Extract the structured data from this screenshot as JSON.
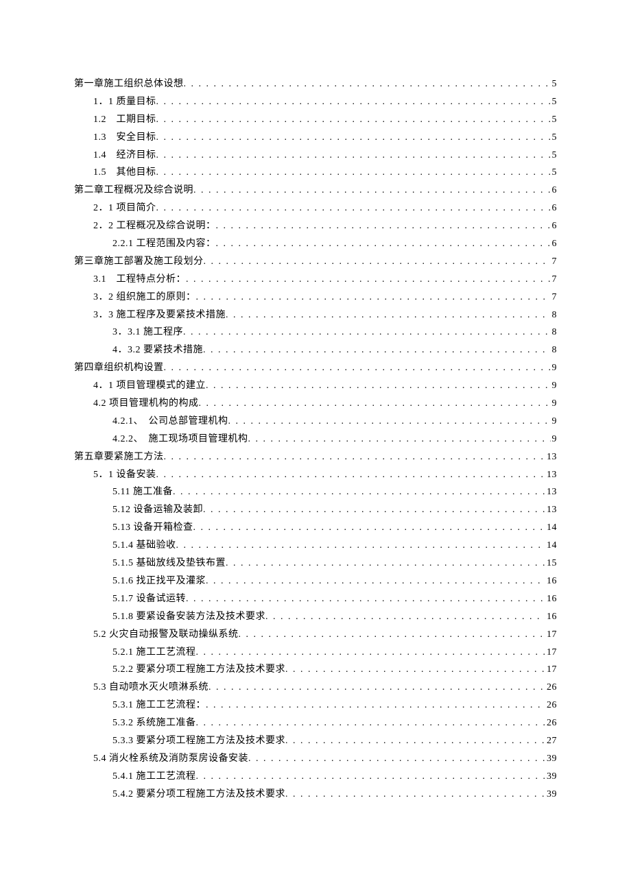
{
  "toc": [
    {
      "level": 0,
      "title": "第一章施工组织总体设想",
      "page": "5"
    },
    {
      "level": 1,
      "title": "1．1 质量目标",
      "page": "5"
    },
    {
      "level": 1,
      "title": "1.2　工期目标",
      "page": "5"
    },
    {
      "level": 1,
      "title": "1.3　安全目标",
      "page": "5"
    },
    {
      "level": 1,
      "title": "1.4　经济目标",
      "page": "5"
    },
    {
      "level": 1,
      "title": "1.5　其他目标",
      "page": "5"
    },
    {
      "level": 0,
      "title": "第二章工程概况及综合说明",
      "page": "6"
    },
    {
      "level": 1,
      "title": "2．1 项目简介",
      "page": "6"
    },
    {
      "level": 1,
      "title": "2．2 工程概况及综合说明：",
      "page": "6"
    },
    {
      "level": 2,
      "title": "2.2.1 工程范围及内容：",
      "page": "6"
    },
    {
      "level": 0,
      "title": "第三章施工部署及施工段划分",
      "page": "7"
    },
    {
      "level": 1,
      "title": "3.1　工程特点分析：",
      "page": "7"
    },
    {
      "level": 1,
      "title": "3．2 组织施工的原则：",
      "page": "7"
    },
    {
      "level": 1,
      "title": "3．3 施工程序及要紧技术措施",
      "page": "8"
    },
    {
      "level": 2,
      "title": "3．3.1 施工程序",
      "page": "8"
    },
    {
      "level": 2,
      "title": "4．3.2 要紧技术措施",
      "page": "8"
    },
    {
      "level": 0,
      "title": "第四章组织机构设置",
      "page": "9"
    },
    {
      "level": 1,
      "title": "4．1 项目管理模式的建立",
      "page": "9"
    },
    {
      "level": 1,
      "title": "4.2 项目管理机构的构成",
      "page": "9"
    },
    {
      "level": 2,
      "title": "4.2.1、　公司总部管理机构",
      "page": "9"
    },
    {
      "level": 2,
      "title": "4.2.2、　施工现场项目管理机构",
      "page": "9"
    },
    {
      "level": 0,
      "title": "第五章要紧施工方法",
      "page": "13"
    },
    {
      "level": 1,
      "title": "5．1 设备安装",
      "page": "13"
    },
    {
      "level": 2,
      "title": "5.11 施工准备",
      "page": "13"
    },
    {
      "level": 2,
      "title": "5.12 设备运输及装卸",
      "page": "13"
    },
    {
      "level": 2,
      "title": "5.13 设备开箱检查",
      "page": "14"
    },
    {
      "level": 2,
      "title": "5.1.4 基础验收",
      "page": "14"
    },
    {
      "level": 2,
      "title": "5.1.5 基础放线及垫铁布置",
      "page": "15"
    },
    {
      "level": 2,
      "title": "5.1.6 找正找平及灌浆",
      "page": "16"
    },
    {
      "level": 2,
      "title": "5.1.7 设备试运转",
      "page": "16"
    },
    {
      "level": 2,
      "title": "5.1.8 要紧设备安装方法及技术要求",
      "page": "16"
    },
    {
      "level": 1,
      "title": "5.2 火灾自动报警及联动操纵系统",
      "page": "17"
    },
    {
      "level": 2,
      "title": "5.2.1 施工工艺流程",
      "page": "17"
    },
    {
      "level": 2,
      "title": "5.2.2 要紧分项工程施工方法及技术要求",
      "page": "17"
    },
    {
      "level": 1,
      "title": "5.3 自动喷水灭火喷淋系统",
      "page": "26"
    },
    {
      "level": 2,
      "title": "5.3.1 施工工艺流程：",
      "page": "26"
    },
    {
      "level": 2,
      "title": "5.3.2 系统施工准备",
      "page": "26"
    },
    {
      "level": 2,
      "title": "5.3.3 要紧分项工程施工方法及技术要求",
      "page": "27"
    },
    {
      "level": 1,
      "title": "5.4 消火栓系统及消防泵房设备安装",
      "page": "39"
    },
    {
      "level": 2,
      "title": "5.4.1 施工工艺流程",
      "page": "39"
    },
    {
      "level": 2,
      "title": "5.4.2 要紧分项工程施工方法及技术要求",
      "page": "39"
    }
  ]
}
